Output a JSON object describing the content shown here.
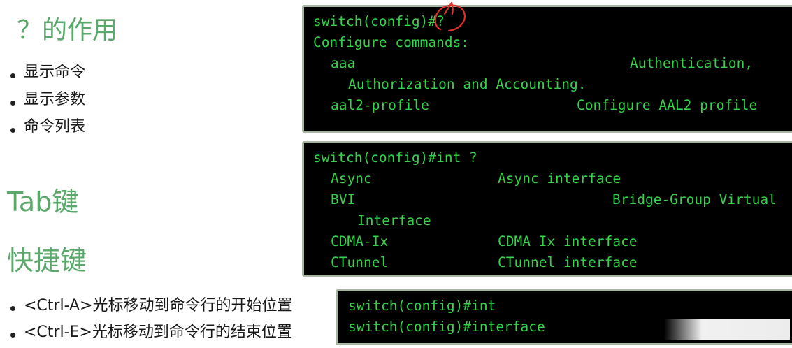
{
  "left": {
    "heading_question": "？的作用",
    "bullets_question": [
      "显示命令",
      "显示参数",
      "命令列表"
    ],
    "heading_tab": "Tab键",
    "heading_shortcut": "快捷键",
    "bullets_shortcut": [
      "<Ctrl-A>光标移动到命令行的开始位置",
      "<Ctrl-E>光标移动到命令行的结束位置"
    ]
  },
  "terminal1": {
    "prompt": "switch(config)#?",
    "header": "Configure commands:",
    "aaa_cmd": "aaa",
    "aaa_desc1": "Authentication,",
    "aaa_desc2": "Authorization and Accounting.",
    "aal2_cmd": "aal2-profile",
    "aal2_desc": "Configure AAL2 profile"
  },
  "terminal2": {
    "prompt": "switch(config)#int ?",
    "async_cmd": "Async",
    "async_desc": "Async interface",
    "bvi_cmd": "BVI",
    "bvi_desc1": "Bridge-Group Virtual",
    "bvi_desc2": "Interface",
    "cdma_cmd": "CDMA-Ix",
    "cdma_desc": "CDMA Ix interface",
    "ctunnel_cmd": "CTunnel",
    "ctunnel_desc": "CTunnel interface"
  },
  "terminal3": {
    "line1": "switch(config)#int",
    "line2": "switch(config)#interface"
  },
  "colors": {
    "heading_green": "#5aa86a",
    "terminal_text": "#33d24a",
    "terminal_bg": "#000000",
    "annotation_red": "#e0302a"
  }
}
